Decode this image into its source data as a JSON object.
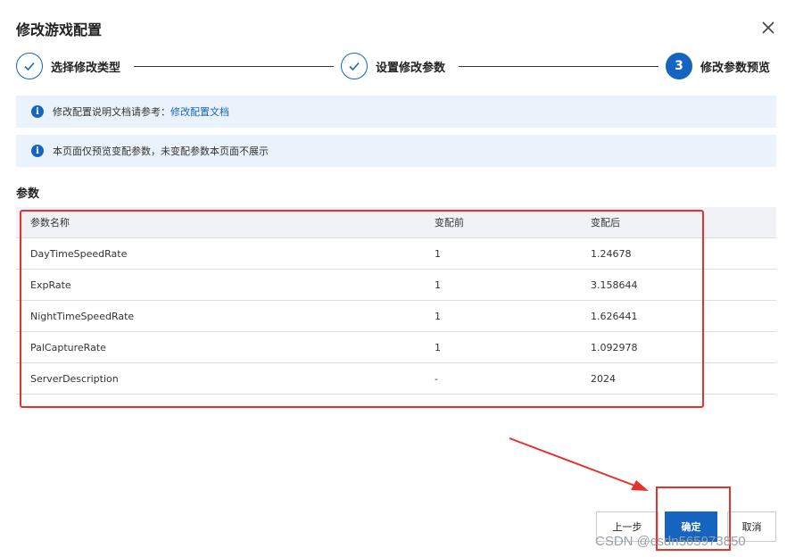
{
  "dialog": {
    "title": "修改游戏配置"
  },
  "steps": [
    {
      "label": "选择修改类型",
      "state": "done"
    },
    {
      "label": "设置修改参数",
      "state": "done"
    },
    {
      "label": "修改参数预览",
      "state": "active",
      "number": "3"
    }
  ],
  "notices": [
    {
      "text": "修改配置说明文档请参考：",
      "link": "修改配置文档"
    },
    {
      "text": "本页面仅预览变配参数，未变配参数本页面不展示"
    }
  ],
  "params": {
    "title": "参数",
    "columns": [
      "参数名称",
      "变配前",
      "变配后"
    ],
    "rows": [
      [
        "DayTimeSpeedRate",
        "1",
        "1.24678"
      ],
      [
        "ExpRate",
        "1",
        "3.158644"
      ],
      [
        "NightTimeSpeedRate",
        "1",
        "1.626441"
      ],
      [
        "PalCaptureRate",
        "1",
        "1.092978"
      ],
      [
        "ServerDescription",
        "-",
        "2024"
      ]
    ]
  },
  "footer": {
    "prev_label": "上一步",
    "confirm_label": "确定",
    "cancel_label": "取消"
  },
  "watermark": "CSDN @csdn565973850",
  "colors": {
    "primary": "#1565c0",
    "annotation": "#e5322d",
    "notice_bg": "#eaf2fb"
  }
}
